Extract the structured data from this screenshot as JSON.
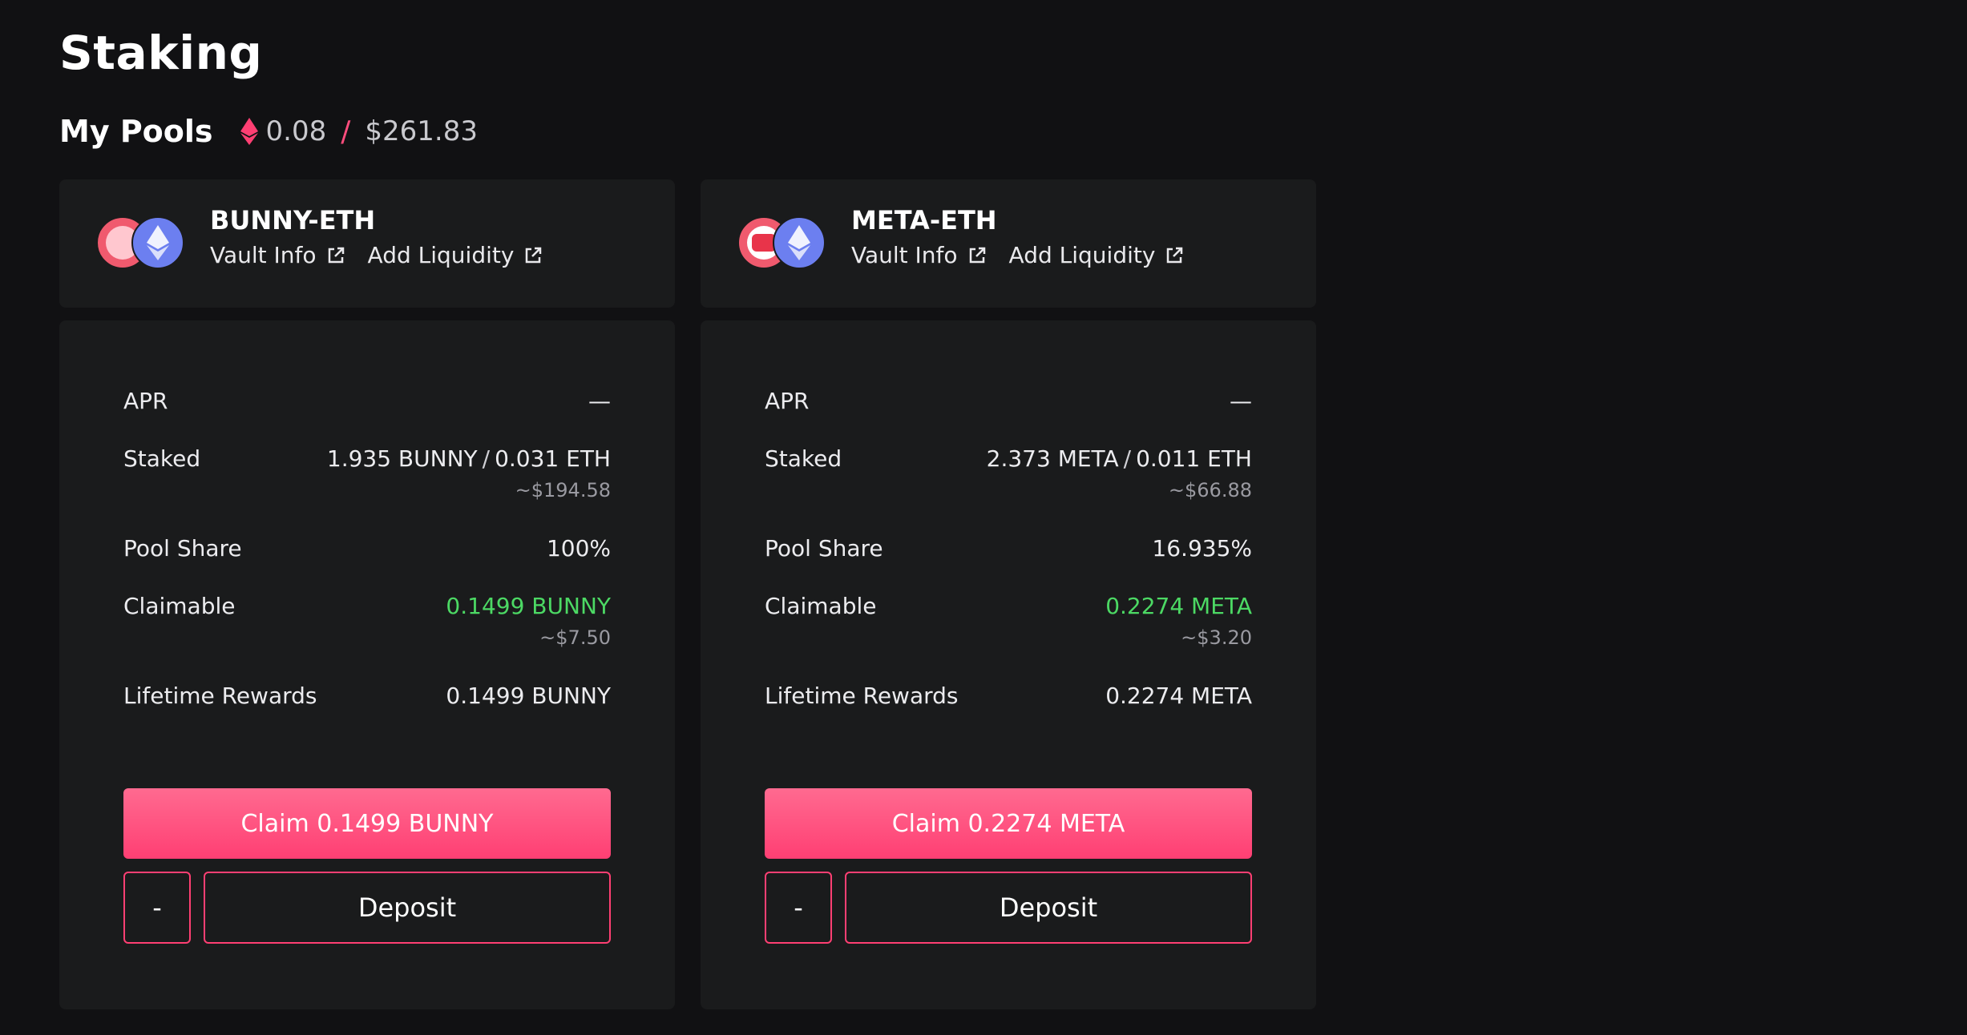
{
  "page": {
    "title": "Staking"
  },
  "summary": {
    "label": "My Pools",
    "eth_amount": "0.08",
    "separator": "/",
    "usd_amount": "$261.83",
    "accent_color": "#ff3f73"
  },
  "pools": [
    {
      "name": "BUNNY-ETH",
      "vault_info_label": "Vault Info",
      "add_liquidity_label": "Add Liquidity",
      "token_icons": [
        "bunny-token-icon",
        "eth-token-icon"
      ],
      "apr_label": "APR",
      "apr_value": "—",
      "staked_label": "Staked",
      "staked_token_a": "1.935 BUNNY",
      "staked_separator": "/",
      "staked_token_b": "0.031 ETH",
      "staked_usd": "~$194.58",
      "pool_share_label": "Pool Share",
      "pool_share_value": "100%",
      "claimable_label": "Claimable",
      "claimable_value": "0.1499 BUNNY",
      "claimable_usd": "~$7.50",
      "lifetime_label": "Lifetime Rewards",
      "lifetime_value": "0.1499 BUNNY",
      "claim_button_label": "Claim 0.1499 BUNNY",
      "withdraw_button_label": "-",
      "deposit_button_label": "Deposit"
    },
    {
      "name": "META-ETH",
      "vault_info_label": "Vault Info",
      "add_liquidity_label": "Add Liquidity",
      "token_icons": [
        "meta-token-icon",
        "eth-token-icon"
      ],
      "apr_label": "APR",
      "apr_value": "—",
      "staked_label": "Staked",
      "staked_token_a": "2.373 META",
      "staked_separator": "/",
      "staked_token_b": "0.011 ETH",
      "staked_usd": "~$66.88",
      "pool_share_label": "Pool Share",
      "pool_share_value": "16.935%",
      "claimable_label": "Claimable",
      "claimable_value": "0.2274 META",
      "claimable_usd": "~$3.20",
      "lifetime_label": "Lifetime Rewards",
      "lifetime_value": "0.2274 META",
      "claim_button_label": "Claim 0.2274 META",
      "withdraw_button_label": "-",
      "deposit_button_label": "Deposit"
    }
  ],
  "colors": {
    "background": "#111113",
    "card": "#1a1b1c",
    "claim_green": "#4cd964",
    "button_pink": "#ff3f73"
  }
}
